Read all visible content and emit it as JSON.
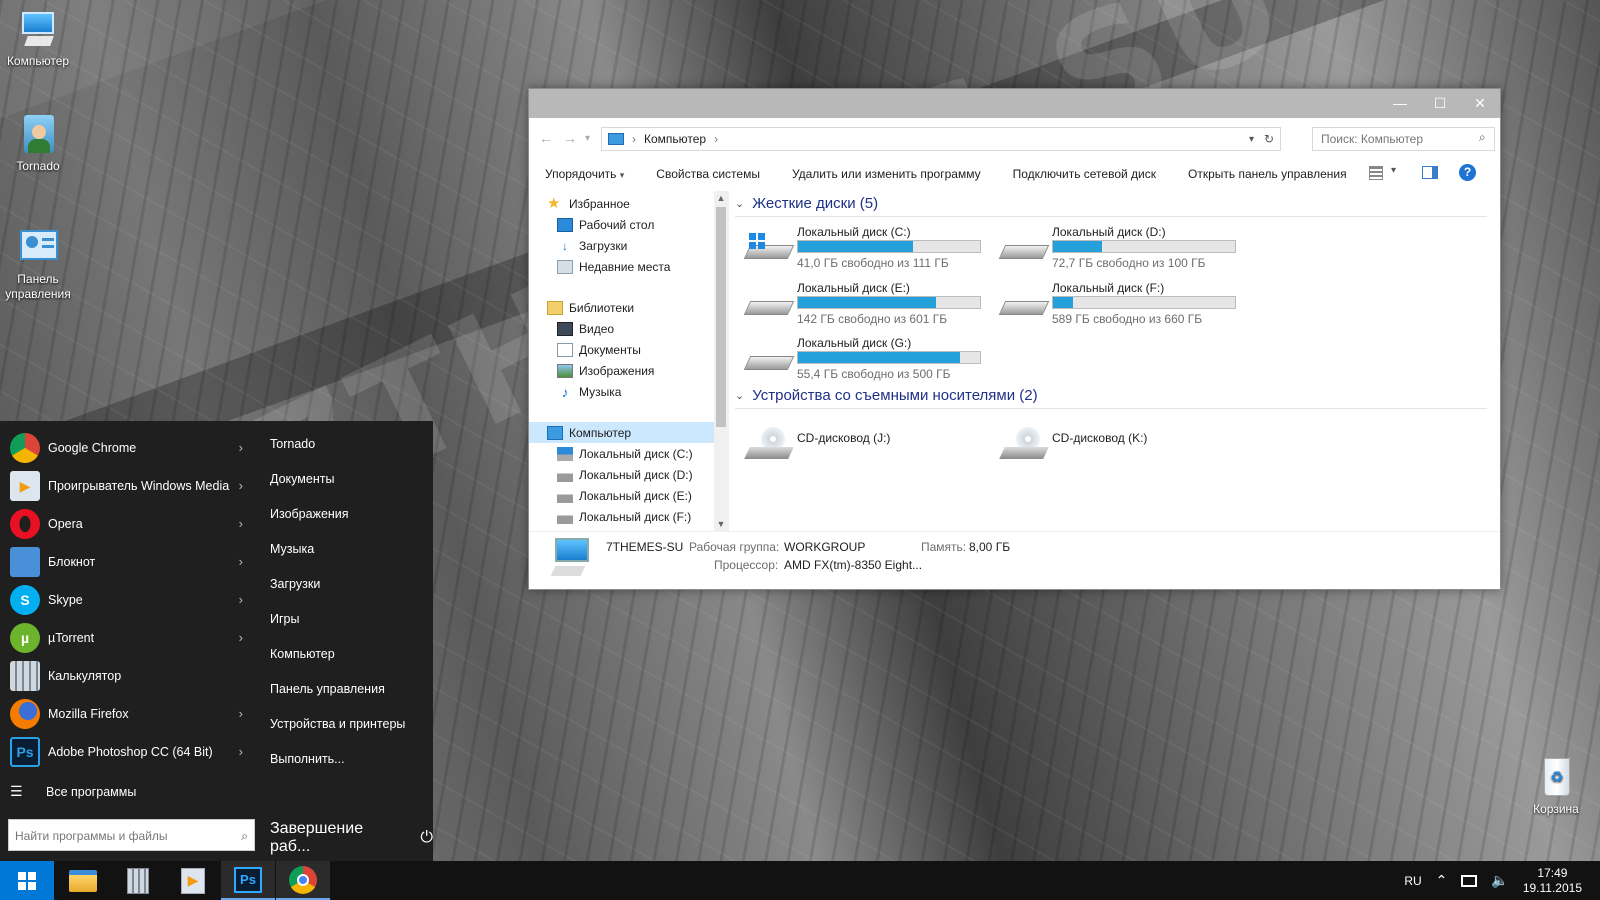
{
  "desktop": {
    "icons": [
      {
        "label": "Компьютер"
      },
      {
        "label": "Tornado"
      },
      {
        "label": "Панель управления"
      },
      {
        "label": "Корзина"
      }
    ],
    "watermark": "7THEMES.SU"
  },
  "start_menu": {
    "apps": [
      {
        "label": "Google Chrome",
        "icon": "chrome-icon",
        "color": "#db4437",
        "has_submenu": true
      },
      {
        "label": "Проигрыватель Windows Media",
        "icon": "media-player-icon",
        "color": "#1e90ff",
        "has_submenu": true
      },
      {
        "label": "Opera",
        "icon": "opera-icon",
        "color": "#e81123",
        "has_submenu": true
      },
      {
        "label": "Блокнот",
        "icon": "notepad-icon",
        "color": "#4a90d9",
        "has_submenu": true
      },
      {
        "label": "Skype",
        "icon": "skype-icon",
        "color": "#00aff0",
        "has_submenu": true
      },
      {
        "label": "µTorrent",
        "icon": "utorrent-icon",
        "color": "#6bb42c",
        "has_submenu": true
      },
      {
        "label": "Калькулятор",
        "icon": "calculator-icon",
        "color": "#9fb8d0",
        "has_submenu": false
      },
      {
        "label": "Mozilla Firefox",
        "icon": "firefox-icon",
        "color": "#f57c00",
        "has_submenu": true
      },
      {
        "label": "Adobe Photoshop CC (64 Bit)",
        "icon": "photoshop-icon",
        "color": "#2aa1e6",
        "has_submenu": true
      }
    ],
    "places": [
      "Tornado",
      "Документы",
      "Изображения",
      "Музыка",
      "Загрузки",
      "Игры",
      "Компьютер",
      "Панель управления",
      "Устройства и принтеры",
      "Выполнить..."
    ],
    "all_programs": "Все программы",
    "search_placeholder": "Найти программы и файлы",
    "shutdown_label": "Завершение раб..."
  },
  "taskbar": {
    "pinned": [
      "file-explorer-icon",
      "calculator-icon",
      "media-player-icon",
      "photoshop-icon",
      "chrome-icon"
    ],
    "lang": "RU",
    "time": "17:49",
    "date": "19.11.2015"
  },
  "explorer": {
    "breadcrumb": "Компьютер",
    "search_placeholder": "Поиск: Компьютер",
    "commands": [
      "Упорядочить",
      "Свойства системы",
      "Удалить или изменить программу",
      "Подключить сетевой диск",
      "Открыть панель управления"
    ],
    "nav": {
      "favorites": "Избранное",
      "favorites_items": [
        "Рабочий стол",
        "Загрузки",
        "Недавние места"
      ],
      "libraries": "Библиотеки",
      "library_items": [
        "Видео",
        "Документы",
        "Изображения",
        "Музыка"
      ],
      "computer": "Компьютер",
      "computer_items": [
        "Локальный диск (C:)",
        "Локальный диск (D:)",
        "Локальный диск (E:)",
        "Локальный диск (F:)"
      ]
    },
    "hard_disks_title": "Жесткие диски (5)",
    "drives": [
      {
        "name": "Локальный диск (C:)",
        "free": "41,0 ГБ свободно из 111 ГБ",
        "used_fraction": 0.63,
        "system": true
      },
      {
        "name": "Локальный диск (D:)",
        "free": "72,7 ГБ свободно из 100 ГБ",
        "used_fraction": 0.27,
        "system": false
      },
      {
        "name": "Локальный диск (E:)",
        "free": "142 ГБ свободно из 601 ГБ",
        "used_fraction": 0.76,
        "system": false
      },
      {
        "name": "Локальный диск (F:)",
        "free": "589 ГБ свободно из 660 ГБ",
        "used_fraction": 0.11,
        "system": false
      },
      {
        "name": "Локальный диск (G:)",
        "free": "55,4 ГБ свободно из 500 ГБ",
        "used_fraction": 0.89,
        "system": false
      }
    ],
    "removable_title": "Устройства со съемными носителями (2)",
    "cd_drives": [
      "CD-дисковод (J:)",
      "CD-дисковод (K:)"
    ],
    "details": {
      "name": "7THEMES-SU",
      "workgroup_label": "Рабочая группа:",
      "workgroup": "WORKGROUP",
      "memory_label": "Память:",
      "memory": "8,00 ГБ",
      "cpu_label": "Процессор:",
      "cpu": "AMD FX(tm)-8350 Eight..."
    }
  },
  "colors": {
    "accent": "#0078d7",
    "bar_fill": "#26a0da",
    "start_bg": "#1f1f1f"
  }
}
